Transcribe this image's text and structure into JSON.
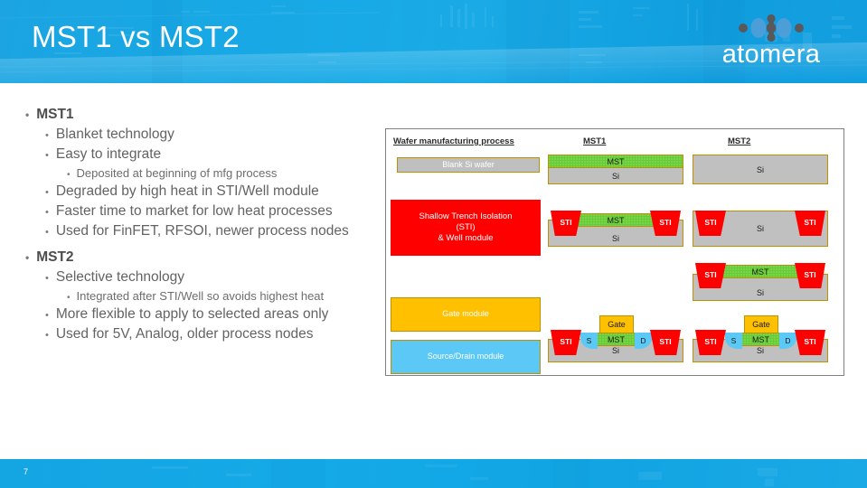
{
  "header": {
    "title": "MST1 vs MST2",
    "logo_text": "atomera",
    "logo_mark": "molecule-icon",
    "brand_blue": "#17a9e6",
    "title_color": "#ffffff"
  },
  "body": {
    "bullets": [
      {
        "level": 1,
        "text": "MST1",
        "marker": "•"
      },
      {
        "level": 2,
        "text": "Blanket technology",
        "marker": "•"
      },
      {
        "level": 2,
        "text": "Easy to integrate",
        "marker": "•"
      },
      {
        "level": 3,
        "text": "Deposited at beginning of mfg process",
        "marker": "•"
      },
      {
        "level": 2,
        "text": "Degraded by high heat in STI/Well module",
        "marker": "•"
      },
      {
        "level": 2,
        "text": "Faster time to market for low heat processes",
        "marker": "•"
      },
      {
        "level": 2,
        "text": "Used for FinFET, RFSOI, newer process nodes",
        "marker": "•"
      },
      {
        "level": 1,
        "text": "MST2",
        "marker": "•"
      },
      {
        "level": 2,
        "text": "Selective technology",
        "marker": "•"
      },
      {
        "level": 3,
        "text": "Integrated after STI/Well so avoids highest heat",
        "marker": "•"
      },
      {
        "level": 2,
        "text": "More flexible to apply to selected areas only",
        "marker": "•"
      },
      {
        "level": 2,
        "text": "Used for 5V, Analog, older process nodes",
        "marker": "•"
      }
    ]
  },
  "diagram": {
    "column_headers": {
      "process": "Wafer manufacturing process",
      "mst1": "MST1",
      "mst2": "MST2"
    },
    "modules": [
      {
        "id": "blank-si-wafer",
        "label": "Blank Si wafer",
        "color": "#bfbfbf"
      },
      {
        "id": "sti-well-module",
        "label": "Shallow Trench Isolation\n(STI)\n& Well module",
        "color": "#ff0000"
      },
      {
        "id": "gate-module",
        "label": "Gate module",
        "color": "#ffc000"
      },
      {
        "id": "source-drain-module",
        "label": "Source/Drain module",
        "color": "#5bc8f5"
      }
    ],
    "module_sti_lines": [
      "Shallow Trench Isolation",
      "(STI)",
      "& Well module"
    ],
    "layer_labels": {
      "silicon": "Si",
      "mst": "MST",
      "sti": "STI",
      "gate": "Gate",
      "source": "S",
      "drain": "D"
    },
    "colors": {
      "silicon": "#c0c0c0",
      "mst": "#66cc33",
      "sti": "#ff0000",
      "gate": "#ffc000",
      "source_drain": "#5bc8f5",
      "outline": "#bf9000"
    }
  },
  "footer": {
    "page_number": "7"
  }
}
